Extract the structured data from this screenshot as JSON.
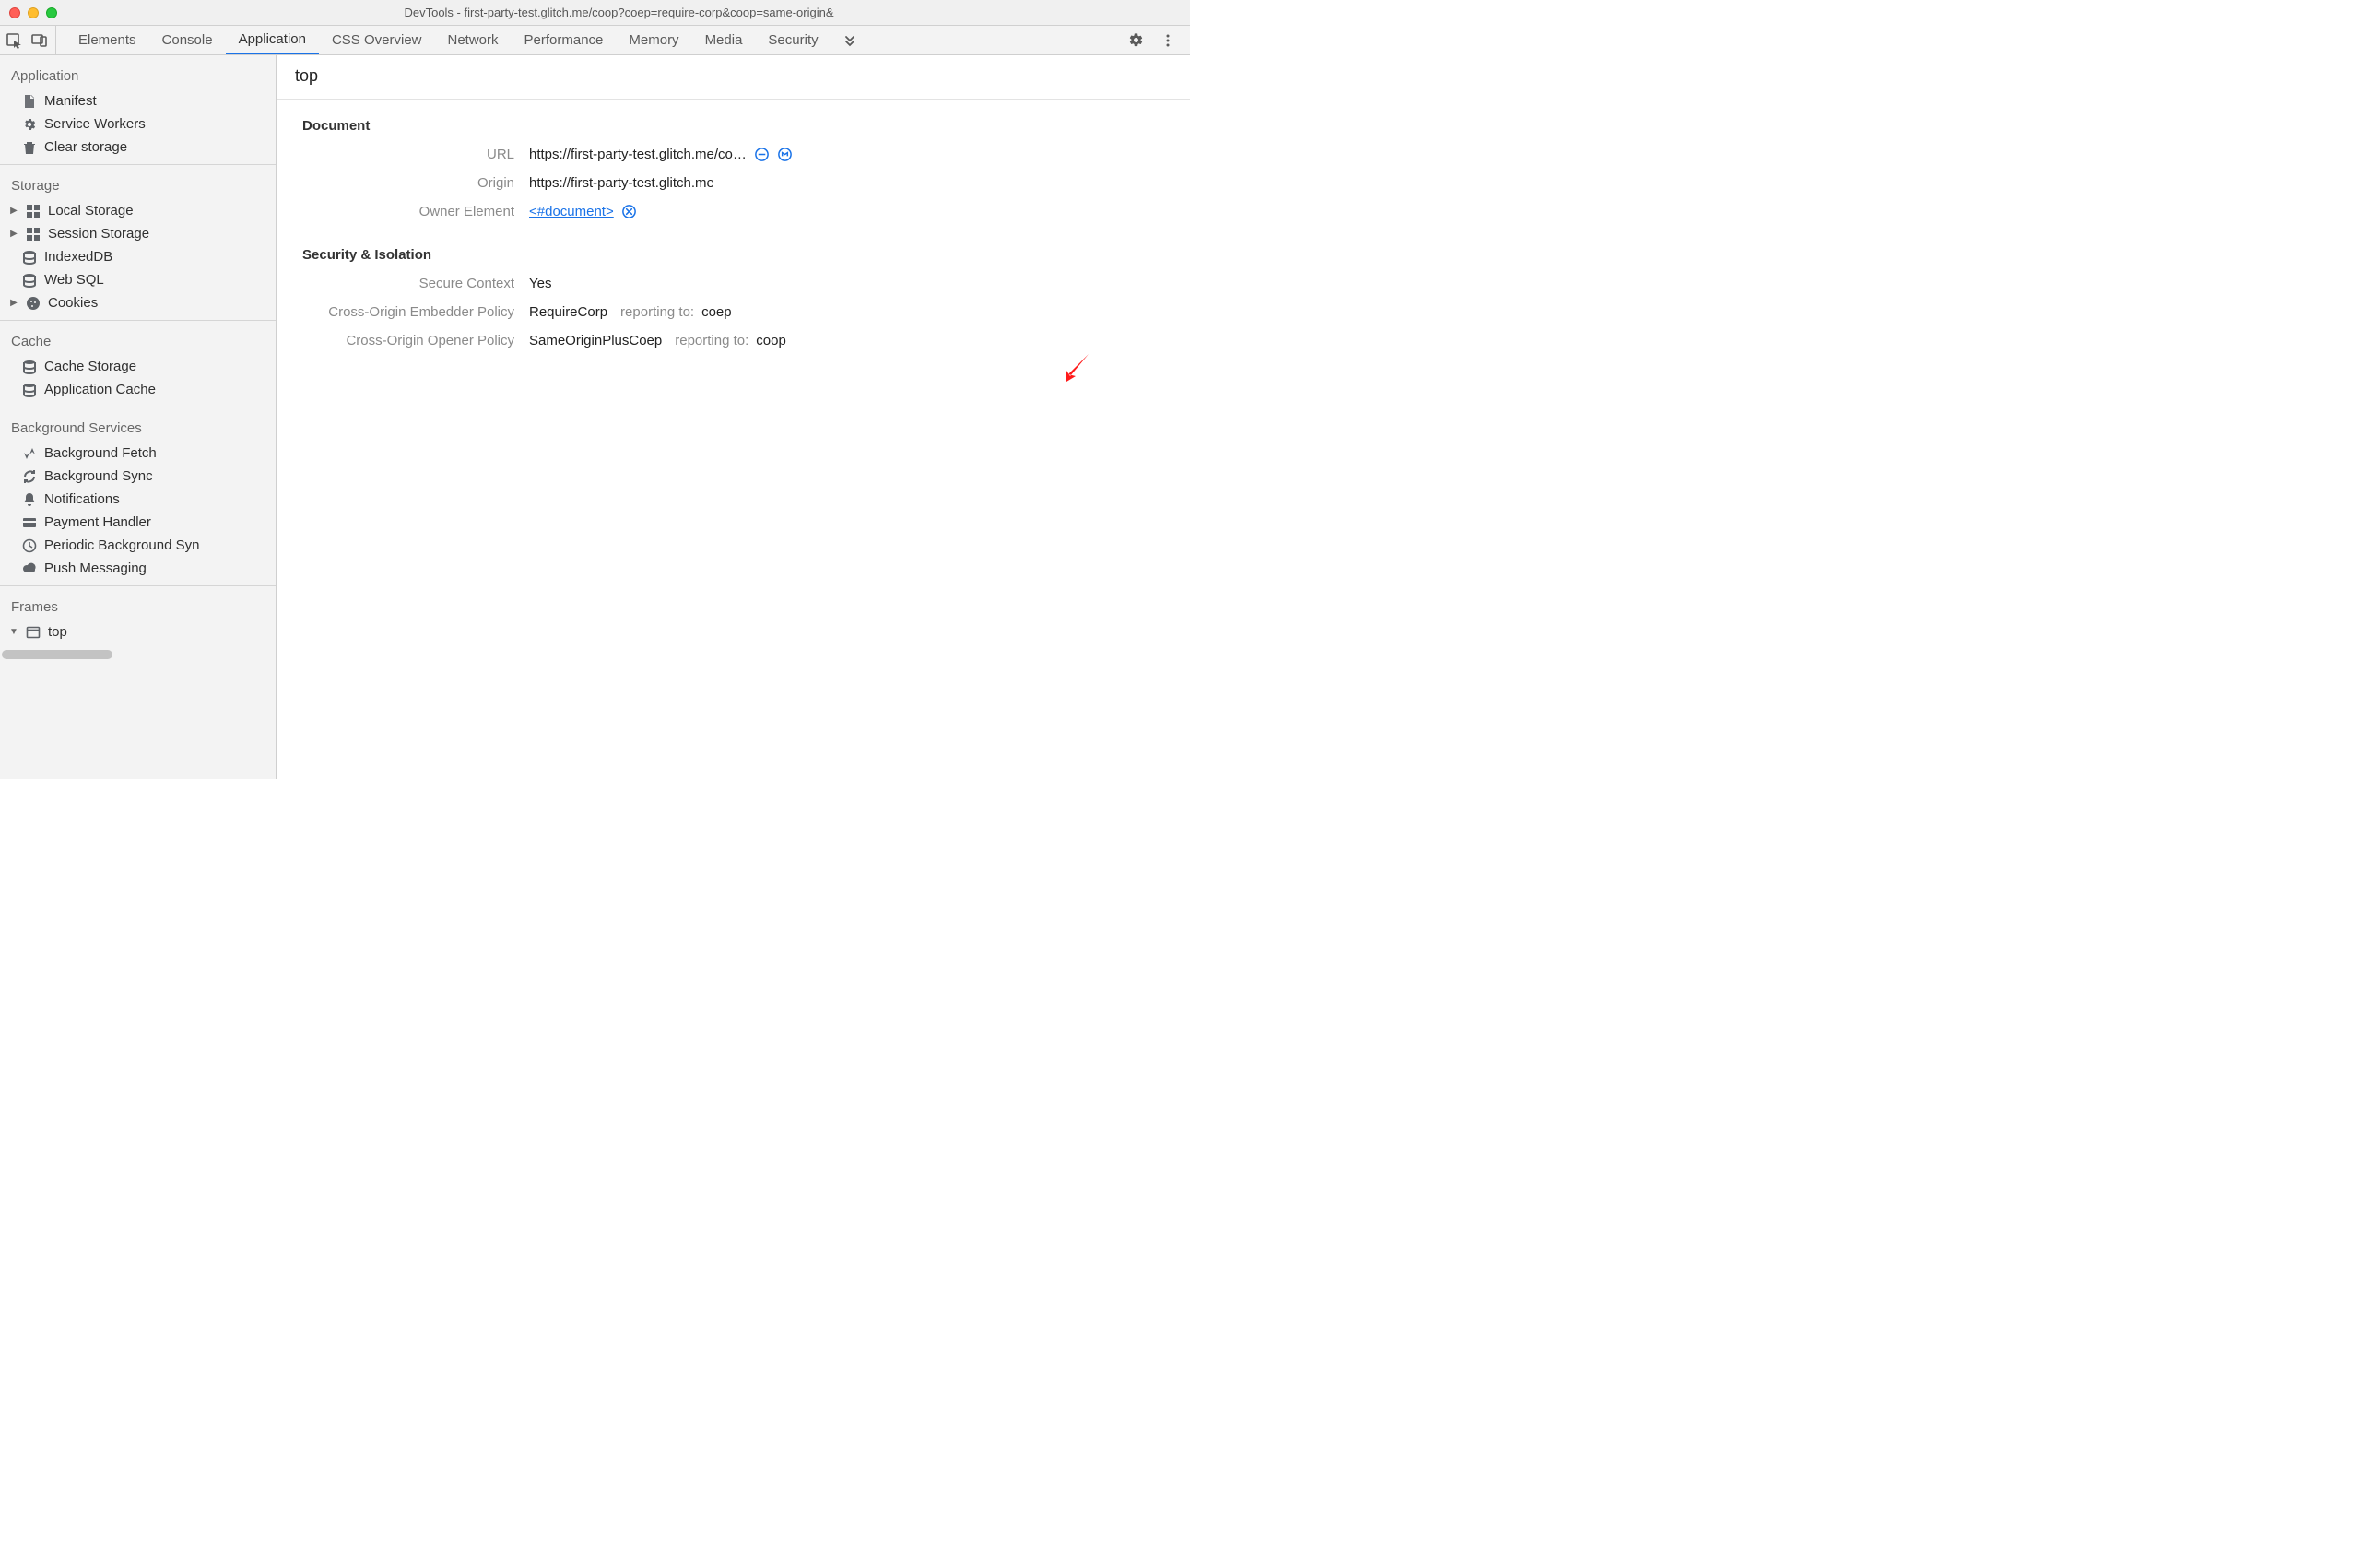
{
  "window_title": "DevTools - first-party-test.glitch.me/coop?coep=require-corp&coop=same-origin&",
  "tabs": {
    "items": [
      "Elements",
      "Console",
      "Application",
      "CSS Overview",
      "Network",
      "Performance",
      "Memory",
      "Media",
      "Security"
    ],
    "active_index": 2
  },
  "sidebar": {
    "groups": [
      {
        "title": "Application",
        "items": [
          {
            "icon": "file-icon",
            "label": "Manifest"
          },
          {
            "icon": "gear-icon",
            "label": "Service Workers"
          },
          {
            "icon": "trash-icon",
            "label": "Clear storage"
          }
        ]
      },
      {
        "title": "Storage",
        "items": [
          {
            "icon": "grid-icon",
            "label": "Local Storage",
            "expandable": true
          },
          {
            "icon": "grid-icon",
            "label": "Session Storage",
            "expandable": true
          },
          {
            "icon": "db-icon",
            "label": "IndexedDB"
          },
          {
            "icon": "db-icon",
            "label": "Web SQL"
          },
          {
            "icon": "cookie-icon",
            "label": "Cookies",
            "expandable": true
          }
        ]
      },
      {
        "title": "Cache",
        "items": [
          {
            "icon": "db-icon",
            "label": "Cache Storage"
          },
          {
            "icon": "db-icon",
            "label": "Application Cache"
          }
        ]
      },
      {
        "title": "Background Services",
        "items": [
          {
            "icon": "updown-icon",
            "label": "Background Fetch"
          },
          {
            "icon": "sync-icon",
            "label": "Background Sync"
          },
          {
            "icon": "bell-icon",
            "label": "Notifications"
          },
          {
            "icon": "card-icon",
            "label": "Payment Handler"
          },
          {
            "icon": "clock-icon",
            "label": "Periodic Background Syn"
          },
          {
            "icon": "cloud-icon",
            "label": "Push Messaging"
          }
        ]
      },
      {
        "title": "Frames",
        "items": [
          {
            "icon": "frame-icon",
            "label": "top",
            "expandable": true,
            "expanded": true
          }
        ]
      }
    ]
  },
  "content": {
    "title": "top",
    "sections": {
      "document": {
        "heading": "Document",
        "url_label": "URL",
        "url_value": "https://first-party-test.glitch.me/co…",
        "origin_label": "Origin",
        "origin_value": "https://first-party-test.glitch.me",
        "owner_label": "Owner Element",
        "owner_value": "<#document>"
      },
      "security": {
        "heading": "Security & Isolation",
        "secure_label": "Secure Context",
        "secure_value": "Yes",
        "coep_label": "Cross-Origin Embedder Policy",
        "coep_value": "RequireCorp",
        "coep_report_label": "reporting to:",
        "coep_report_value": "coep",
        "coop_label": "Cross-Origin Opener Policy",
        "coop_value": "SameOriginPlusCoep",
        "coop_report_label": "reporting to:",
        "coop_report_value": "coop"
      }
    }
  }
}
